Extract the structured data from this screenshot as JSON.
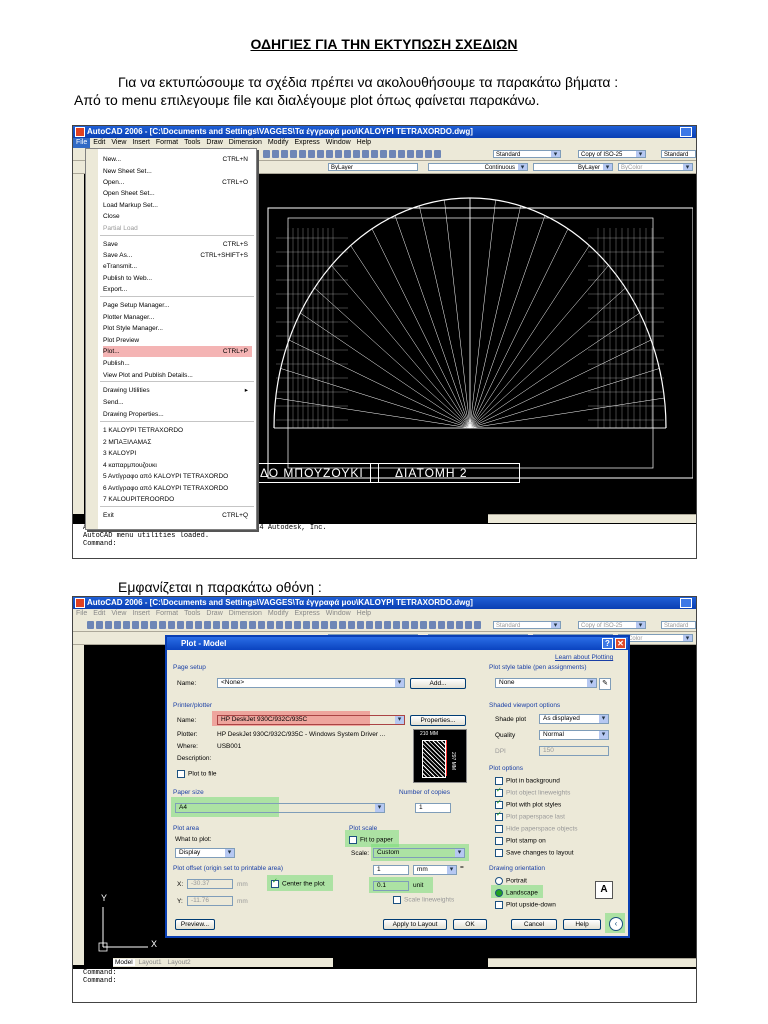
{
  "doc": {
    "title": "ΟΔΗΓΙΕΣ ΓΙΑ ΤΗΝ ΕΚΤΥΠΩΣΗ ΣΧΕΔΙΩΝ",
    "intro_line1": "Για να εκτυπώσουμε τα σχέδια πρέπει να ακολουθήσουμε τα παρακάτω βήματα :",
    "intro_line2": "Από το menu επιλεγουμε file και διαλέγουμε plot όπως φαίνεται παρακάνω.",
    "second_caption": "Εμφανίζεται η παρακάτω οθόνη :"
  },
  "app": {
    "window_title": "AutoCAD 2006 - [C:\\Documents and Settings\\VAGGES\\Τα έγγραφά μου\\KALOYPI TETRAXORDO.dwg]",
    "menus": [
      "File",
      "Edit",
      "View",
      "Insert",
      "Format",
      "Tools",
      "Draw",
      "Dimension",
      "Modify",
      "Express",
      "Window",
      "Help"
    ],
    "text_style": "Standard",
    "dim_style": "Copy of ISO-25",
    "table_style": "Standard",
    "layer_color": "ByLayer",
    "linetype": "Continuous",
    "lineweight": "ByLayer",
    "plot_style": "ByColor"
  },
  "file_menu": {
    "items": [
      {
        "label": "New...",
        "shortcut": "CTRL+N"
      },
      {
        "label": "New Sheet Set...",
        "shortcut": ""
      },
      {
        "label": "Open...",
        "shortcut": "CTRL+O"
      },
      {
        "label": "Open Sheet Set...",
        "shortcut": ""
      },
      {
        "label": "Load Markup Set...",
        "shortcut": ""
      },
      {
        "label": "Close",
        "shortcut": ""
      },
      {
        "label": "Partial Load",
        "shortcut": ""
      },
      {
        "label": "Save",
        "shortcut": "CTRL+S"
      },
      {
        "label": "Save As...",
        "shortcut": "CTRL+SHIFT+S"
      },
      {
        "label": "eTransmit...",
        "shortcut": ""
      },
      {
        "label": "Publish to Web...",
        "shortcut": ""
      },
      {
        "label": "Export...",
        "shortcut": ""
      },
      {
        "label": "Page Setup Manager...",
        "shortcut": ""
      },
      {
        "label": "Plotter Manager...",
        "shortcut": ""
      },
      {
        "label": "Plot Style Manager...",
        "shortcut": ""
      },
      {
        "label": "Plot Preview",
        "shortcut": ""
      },
      {
        "label": "Plot...",
        "shortcut": "CTRL+P"
      },
      {
        "label": "Publish...",
        "shortcut": ""
      },
      {
        "label": "View Plot and Publish Details...",
        "shortcut": ""
      },
      {
        "label": "Drawing Utilities",
        "shortcut": "▸"
      },
      {
        "label": "Send...",
        "shortcut": ""
      },
      {
        "label": "Drawing Properties...",
        "shortcut": ""
      },
      {
        "label": "1 KALOYPI TETRAXORDO",
        "shortcut": ""
      },
      {
        "label": "2 ΜΠΑΞΙΛΑΜΑΣ",
        "shortcut": ""
      },
      {
        "label": "3 KALOYPI",
        "shortcut": ""
      },
      {
        "label": "4 καπαρμπουζουκι",
        "shortcut": ""
      },
      {
        "label": "5 Αντίγραφο από KALOYPI TETRAXORDO",
        "shortcut": ""
      },
      {
        "label": "6 Αντίγραφο από KALOYPI TETRAXORDO",
        "shortcut": ""
      },
      {
        "label": "7 KALOUPITEROORDO",
        "shortcut": ""
      },
      {
        "label": "Exit",
        "shortcut": "CTRL+Q"
      }
    ]
  },
  "drawing": {
    "label_left": "ΔΟ ΜΠΟΥΖΟΥΚΙ",
    "label_right": "ΔΙΑΤΟΜΗ  2"
  },
  "command_top": {
    "line1": "AutoCAD Express Tools Copyright © 2002-2004 Autodesk, Inc.",
    "line2": "AutoCAD menu utilities loaded.",
    "line3": "Command:"
  },
  "command_bottom": {
    "line1": "Command:",
    "line2": "Command:"
  },
  "layout_tabs": [
    "Model",
    "Layout1",
    "Layout2"
  ],
  "plot_dialog": {
    "title": "Plot - Model",
    "learn_link": "Learn about Plotting",
    "page_setup": {
      "group": "Page setup",
      "name_label": "Name:",
      "name_value": "<None>",
      "add_button": "Add..."
    },
    "printer": {
      "group": "Printer/plotter",
      "name_label": "Name:",
      "name_value": "HP DeskJet 930C/932C/935C",
      "properties_button": "Properties...",
      "plotter_label": "Plotter:",
      "plotter_value": "HP DeskJet 930C/932C/935C - Windows System Driver ...",
      "where_label": "Where:",
      "where_value": "USB001",
      "description_label": "Description:",
      "plot_to_file": "Plot to file",
      "preview_width": "210 MM",
      "preview_height": "297 MM"
    },
    "paper_size": {
      "group": "Paper size",
      "value": "A4"
    },
    "copies": {
      "group": "Number of copies",
      "value": "1"
    },
    "plot_area": {
      "group": "Plot area",
      "what_label": "What to plot:",
      "value": "Display"
    },
    "plot_scale": {
      "group": "Plot scale",
      "fit_to_paper": "Fit to paper",
      "scale_label": "Scale:",
      "scale_value": "Custom",
      "mm_value": "1",
      "mm_unit": "mm",
      "unit_value": "0.1",
      "unit_label": "unit",
      "scale_lineweights": "Scale lineweights"
    },
    "plot_offset": {
      "group": "Plot offset (origin set to printable area)",
      "x_label": "X:",
      "x_value": "-30.37",
      "x_unit": "mm",
      "y_label": "Y:",
      "y_value": "-11.76",
      "y_unit": "mm",
      "center": "Center the plot"
    },
    "style_table": {
      "group": "Plot style table (pen assignments)",
      "value": "None"
    },
    "shaded": {
      "group": "Shaded viewport options",
      "shade_label": "Shade plot",
      "shade_value": "As displayed",
      "quality_label": "Quality",
      "quality_value": "Normal",
      "dpi_label": "DPI",
      "dpi_value": "150"
    },
    "options": {
      "group": "Plot options",
      "items": [
        "Plot in background",
        "Plot object lineweights",
        "Plot with plot styles",
        "Plot paperspace last",
        "Hide paperspace objects",
        "Plot stamp on",
        "Save changes to layout"
      ]
    },
    "orientation": {
      "group": "Drawing orientation",
      "portrait": "Portrait",
      "landscape": "Landscape",
      "upside_down": "Plot upside-down",
      "orientation_icon": "A"
    },
    "buttons": {
      "preview": "Preview...",
      "apply": "Apply to Layout",
      "ok": "OK",
      "cancel": "Cancel",
      "help": "Help"
    },
    "ucs_x": "X",
    "ucs_y": "Y"
  },
  "colors": {
    "highlight_red": "#f08080",
    "highlight_green": "#7fe07f",
    "title_blue": "#0a3fb3"
  }
}
